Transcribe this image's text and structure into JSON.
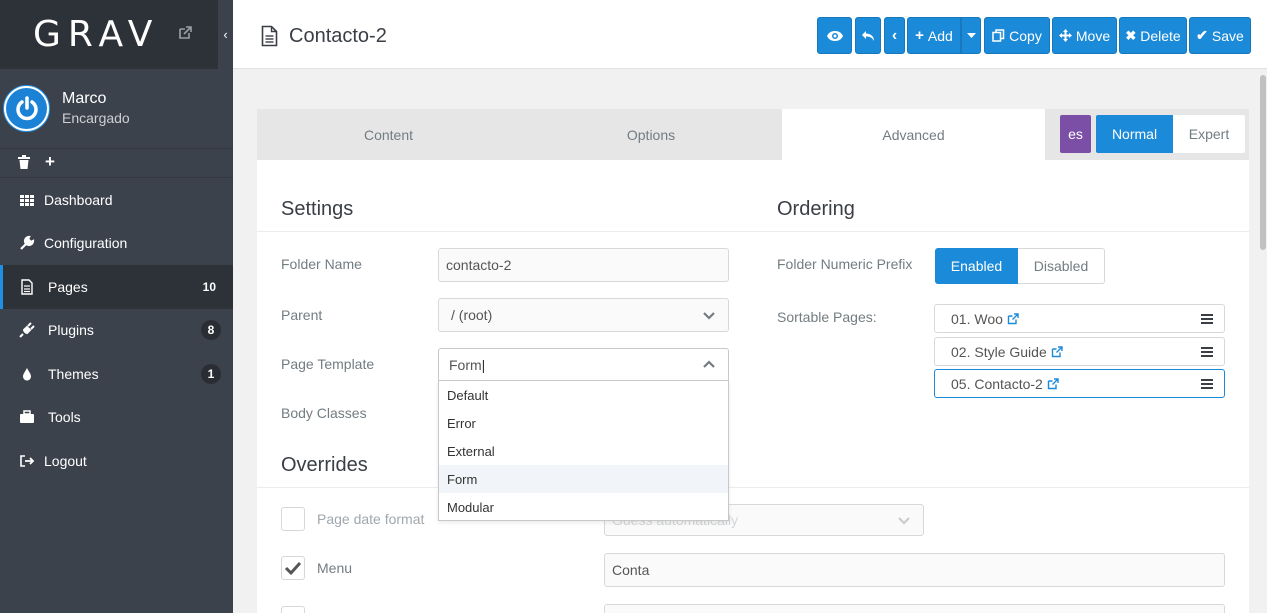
{
  "brand": {
    "logo": "GRAV"
  },
  "user": {
    "name": "Marco",
    "role": "Encargado"
  },
  "nav": [
    {
      "label": "Dashboard",
      "icon": "grid-icon"
    },
    {
      "label": "Configuration",
      "icon": "wrench-icon"
    },
    {
      "label": "Pages",
      "icon": "file-icon",
      "badge": "10",
      "active": true
    },
    {
      "label": "Plugins",
      "icon": "plug-icon",
      "badge": "8"
    },
    {
      "label": "Themes",
      "icon": "drop-icon",
      "badge": "1"
    },
    {
      "label": "Tools",
      "icon": "briefcase-icon"
    },
    {
      "label": "Logout",
      "icon": "signout-icon"
    }
  ],
  "header": {
    "title": "Contacto-2",
    "buttons": {
      "add": "Add",
      "copy": "Copy",
      "move": "Move",
      "delete": "Delete",
      "save": "Save"
    }
  },
  "tabs": [
    {
      "label": "Content"
    },
    {
      "label": "Options"
    },
    {
      "label": "Advanced",
      "active": true
    }
  ],
  "lang": "es",
  "mode": {
    "normal": "Normal",
    "expert": "Expert",
    "active": "Normal"
  },
  "settings": {
    "title": "Settings",
    "folder_name_label": "Folder Name",
    "folder_name_value": "contacto-2",
    "parent_label": "Parent",
    "parent_value": "/ (root)",
    "template_label": "Page Template",
    "template_value": "Form",
    "template_options": [
      "Default",
      "Error",
      "External",
      "Form",
      "Modular"
    ],
    "template_highlighted": "Form",
    "body_classes_label": "Body Classes"
  },
  "ordering": {
    "title": "Ordering",
    "prefix_label": "Folder Numeric Prefix",
    "prefix_enabled": "Enabled",
    "prefix_disabled": "Disabled",
    "prefix_value": "Enabled",
    "sortable_label": "Sortable Pages:",
    "pages": [
      "01. Woo",
      "02. Style Guide",
      "05. Contacto-2"
    ],
    "selected_page": "05. Contacto-2"
  },
  "overrides": {
    "title": "Overrides",
    "date_format_label": "Page date format",
    "date_format_checked": false,
    "date_format_placeholder": "Guess automatically",
    "menu_label": "Menu",
    "menu_checked": true,
    "menu_value": "Conta"
  },
  "colors": {
    "accent": "#1b8ad8",
    "sidebar": "#3c424c",
    "lang_badge": "#7b4fa6"
  }
}
